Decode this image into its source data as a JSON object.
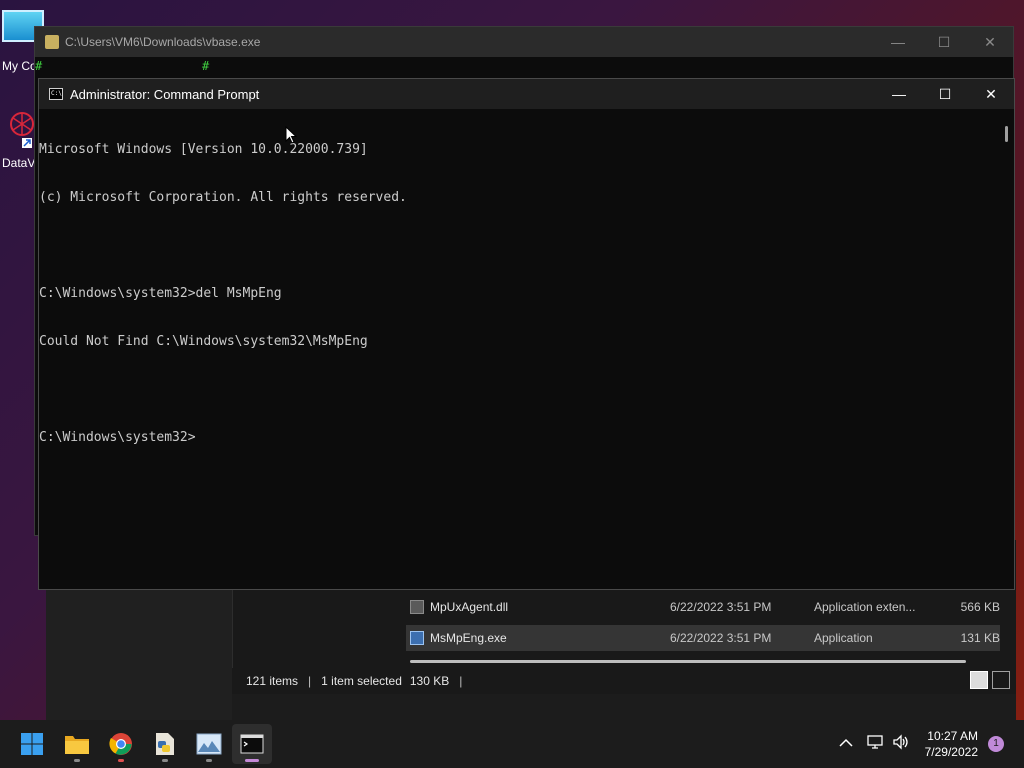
{
  "desktop": {
    "icons": [
      {
        "label": "My Co"
      },
      {
        "label": "DataV"
      }
    ]
  },
  "background_window": {
    "title": "C:\\Users\\VM6\\Downloads\\vbase.exe",
    "hash_char": "#"
  },
  "explorer": {
    "files": [
      {
        "name": "MpUxAgent.dll",
        "date": "6/22/2022 3:51 PM",
        "type": "Application exten...",
        "size": "566 KB",
        "selected": false
      },
      {
        "name": "MsMpEng.exe",
        "date": "6/22/2022 3:51 PM",
        "type": "Application",
        "size": "131 KB",
        "selected": true
      }
    ],
    "status": {
      "items": "121 items",
      "selected": "1 item selected",
      "size": "130 KB"
    }
  },
  "cmd": {
    "title": "Administrator: Command Prompt",
    "lines": [
      "Microsoft Windows [Version 10.0.22000.739]",
      "(c) Microsoft Corporation. All rights reserved.",
      "",
      "C:\\Windows\\system32>del MsMpEng",
      "Could Not Find C:\\Windows\\system32\\MsMpEng",
      "",
      "C:\\Windows\\system32>"
    ]
  },
  "taskbar": {
    "apps": [
      {
        "icon": "windows-start-icon"
      },
      {
        "icon": "file-explorer-icon"
      },
      {
        "icon": "chrome-icon"
      },
      {
        "icon": "python-file-icon"
      },
      {
        "icon": "image-viewer-icon"
      },
      {
        "icon": "terminal-icon"
      }
    ],
    "time": "10:27 AM",
    "date": "7/29/2022",
    "notification_count": "1"
  }
}
